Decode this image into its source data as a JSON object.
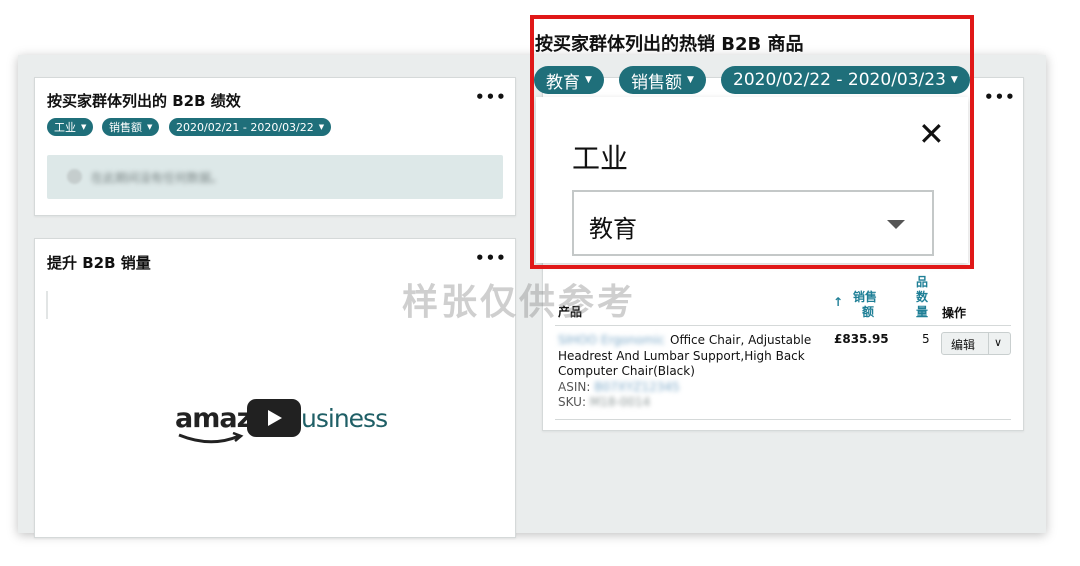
{
  "card_b2b_performance": {
    "title": "按买家群体列出的 B2B 绩效",
    "filters": [
      "工业",
      "销售额",
      "2020/02/21 - 2020/03/22"
    ],
    "notice_text": "在此期间没有任何数据。"
  },
  "card_boost_sales": {
    "title": "提升 B2B 销量",
    "logo_left": "amaz",
    "logo_right": "usiness"
  },
  "card_top_products": {
    "headers": {
      "product": "产品",
      "sort_arrow": "↑",
      "sales": [
        "销售",
        "额"
      ],
      "quantity": [
        "品",
        "数",
        "量"
      ],
      "actions": "操作"
    },
    "row": {
      "brand": "SIHOO Ergonomic",
      "name_line1": "Office Chair, Adjustable",
      "name_line2": "Headrest And Lumbar Support,High Back",
      "name_line3": "Computer Chair(Black)",
      "asin_label": "ASIN:",
      "asin_value": "B07XYZ12345",
      "sku_label": "SKU:",
      "sku_value": "M18-0014",
      "sales": "£835.95",
      "quantity": "5",
      "edit_label": "编辑",
      "edit_caret": "∨"
    }
  },
  "zoom_callout": {
    "title": "按买家群体列出的热销 B2B 商品",
    "filters": [
      "教育",
      "销售额",
      "2020/02/22 - 2020/03/23"
    ],
    "popup": {
      "label": "工业",
      "close_icon": "✕",
      "select_value": "教育"
    }
  },
  "more_icon": "•••",
  "filter_caret": "▼",
  "watermark": "样张仅供参考",
  "colors": {
    "accent": "#1f6f7a",
    "highlight_border": "#e01818",
    "link": "#1f7f96"
  }
}
